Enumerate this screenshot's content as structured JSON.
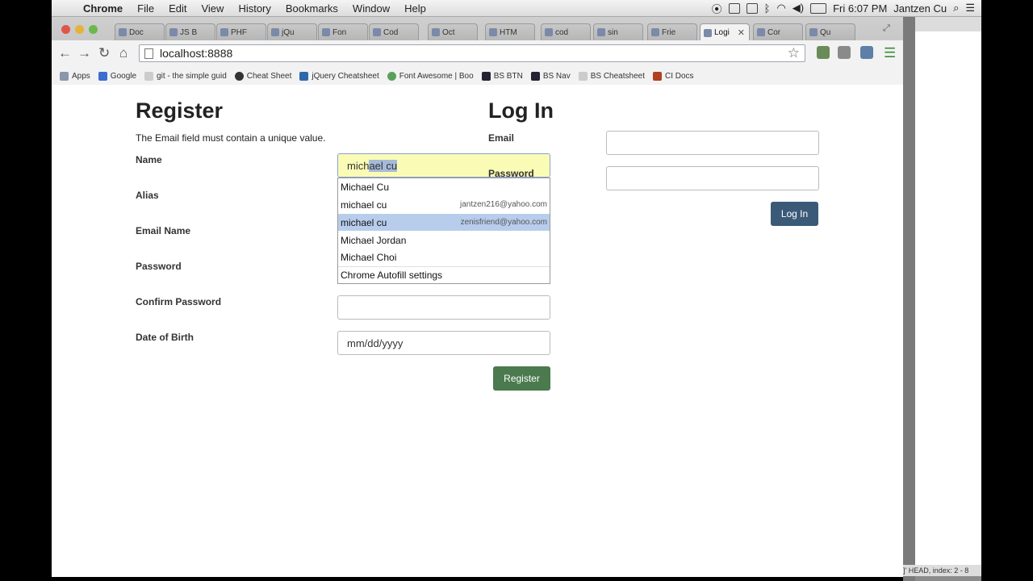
{
  "menubar": {
    "app": "Chrome",
    "menus": [
      "File",
      "Edit",
      "View",
      "History",
      "Bookmarks",
      "Window",
      "Help"
    ],
    "clock": "Fri 6:07 PM",
    "user": "Jantzen Cu"
  },
  "tabs": [
    {
      "label": "Doc"
    },
    {
      "label": "JS B"
    },
    {
      "label": "PHF"
    },
    {
      "label": "jQu"
    },
    {
      "label": "Fon"
    },
    {
      "label": "Cod"
    },
    {
      "label": "Oct"
    },
    {
      "label": "HTM"
    },
    {
      "label": "cod"
    },
    {
      "label": "sin"
    },
    {
      "label": "Frie"
    },
    {
      "label": "Logi",
      "active": true
    },
    {
      "label": "Cor"
    },
    {
      "label": "Qu"
    }
  ],
  "address_bar": {
    "url": "localhost:8888"
  },
  "bookmarks": [
    {
      "label": "Apps"
    },
    {
      "label": "Google"
    },
    {
      "label": "git - the simple guid"
    },
    {
      "label": "Cheat Sheet"
    },
    {
      "label": "jQuery Cheatsheet"
    },
    {
      "label": "Font Awesome | Boo"
    },
    {
      "label": "BS BTN"
    },
    {
      "label": "BS Nav"
    },
    {
      "label": "BS Cheatsheet"
    },
    {
      "label": "CI Docs"
    }
  ],
  "register": {
    "title": "Register",
    "error": "The Email field must contain a unique value.",
    "name_label": "Name",
    "name_value_typed": "mich",
    "name_value_selected": "ael cu",
    "alias_label": "Alias",
    "email_label": "Email Name",
    "password_label": "Password",
    "confirm_label": "Confirm Password",
    "dob_label": "Date of Birth",
    "dob_placeholder": "mm/dd/yyyy",
    "submit": "Register"
  },
  "autofill": {
    "items": [
      {
        "name": "Michael Cu",
        "email": ""
      },
      {
        "name": "michael cu",
        "email": "jantzen216@yahoo.com"
      },
      {
        "name": "michael cu",
        "email": "zenisfriend@yahoo.com",
        "highlighted": true
      },
      {
        "name": "Michael Jordan",
        "email": ""
      },
      {
        "name": "Michael Choi",
        "email": ""
      }
    ],
    "settings": "Chrome Autofill settings"
  },
  "login": {
    "title": "Log In",
    "email_label": "Email",
    "password_label": "Password",
    "submit": "Log In"
  },
  "side_window": {
    "status": "]' HEAD, index: 2 - 8"
  },
  "colors": {
    "register_button": "#4a7a4d",
    "login_button": "#3a5a78",
    "autofill_highlight": "#b8cdec"
  }
}
